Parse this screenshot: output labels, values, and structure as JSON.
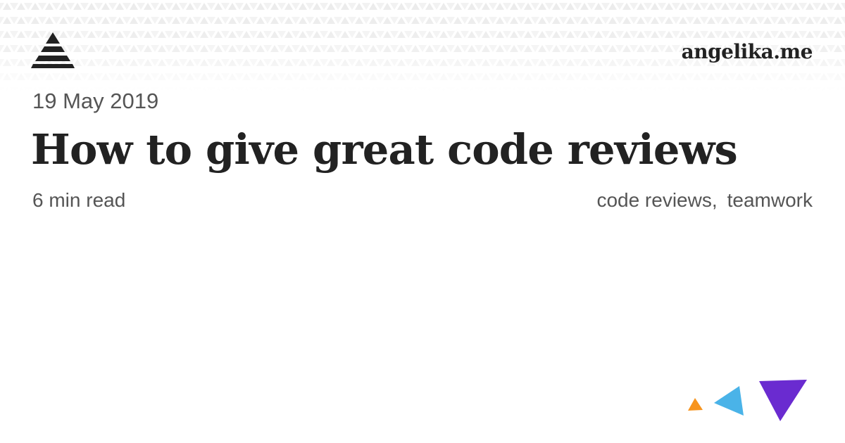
{
  "site": {
    "name": "angelika.me",
    "logo_icon": "pyramid-logo-icon"
  },
  "post": {
    "date": "19 May 2019",
    "title": "How to give great code reviews",
    "read_time": "6 min read",
    "tags": [
      {
        "label": "code reviews",
        "separator": ","
      },
      {
        "label": "teamwork",
        "separator": ""
      }
    ]
  },
  "decoration": {
    "icons": [
      "orange-triangle-icon",
      "blue-triangle-icon",
      "purple-triangle-icon"
    ],
    "colors": {
      "orange": "#f7941d",
      "blue": "#4ab3e8",
      "purple": "#6a2bd0"
    }
  },
  "colors": {
    "text_dark": "#222222",
    "text_muted": "#555555",
    "pattern": "#e9e9e9",
    "background": "#ffffff"
  }
}
